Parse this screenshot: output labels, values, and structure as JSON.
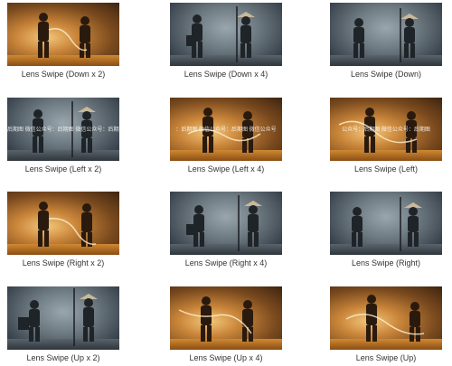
{
  "items": [
    {
      "caption": "Lens Swipe (Down x 2)",
      "tone": "warm",
      "watermark": ""
    },
    {
      "caption": "Lens Swipe (Down x 4)",
      "tone": "cool",
      "watermark": ""
    },
    {
      "caption": "Lens Swipe (Down)",
      "tone": "cool",
      "watermark": ""
    },
    {
      "caption": "Lens Swipe (Left x 2)",
      "tone": "cool",
      "watermark": "后期图 微信公众号：后期图 微信公众号：后期图"
    },
    {
      "caption": "Lens Swipe (Left x 4)",
      "tone": "warm",
      "watermark": "：后期图 微信公众号：后期图 微信公众号"
    },
    {
      "caption": "Lens Swipe (Left)",
      "tone": "warm",
      "watermark": "公众号：后期图 微信公众号：后期图"
    },
    {
      "caption": "Lens Swipe (Right x 2)",
      "tone": "warm",
      "watermark": ""
    },
    {
      "caption": "Lens Swipe (Right x 4)",
      "tone": "cool",
      "watermark": ""
    },
    {
      "caption": "Lens Swipe (Right)",
      "tone": "cool",
      "watermark": ""
    },
    {
      "caption": "Lens Swipe (Up x 2)",
      "tone": "cool",
      "watermark": ""
    },
    {
      "caption": "Lens Swipe (Up x 4)",
      "tone": "warm",
      "watermark": ""
    },
    {
      "caption": "Lens Swipe (Up)",
      "tone": "warm",
      "watermark": ""
    }
  ]
}
